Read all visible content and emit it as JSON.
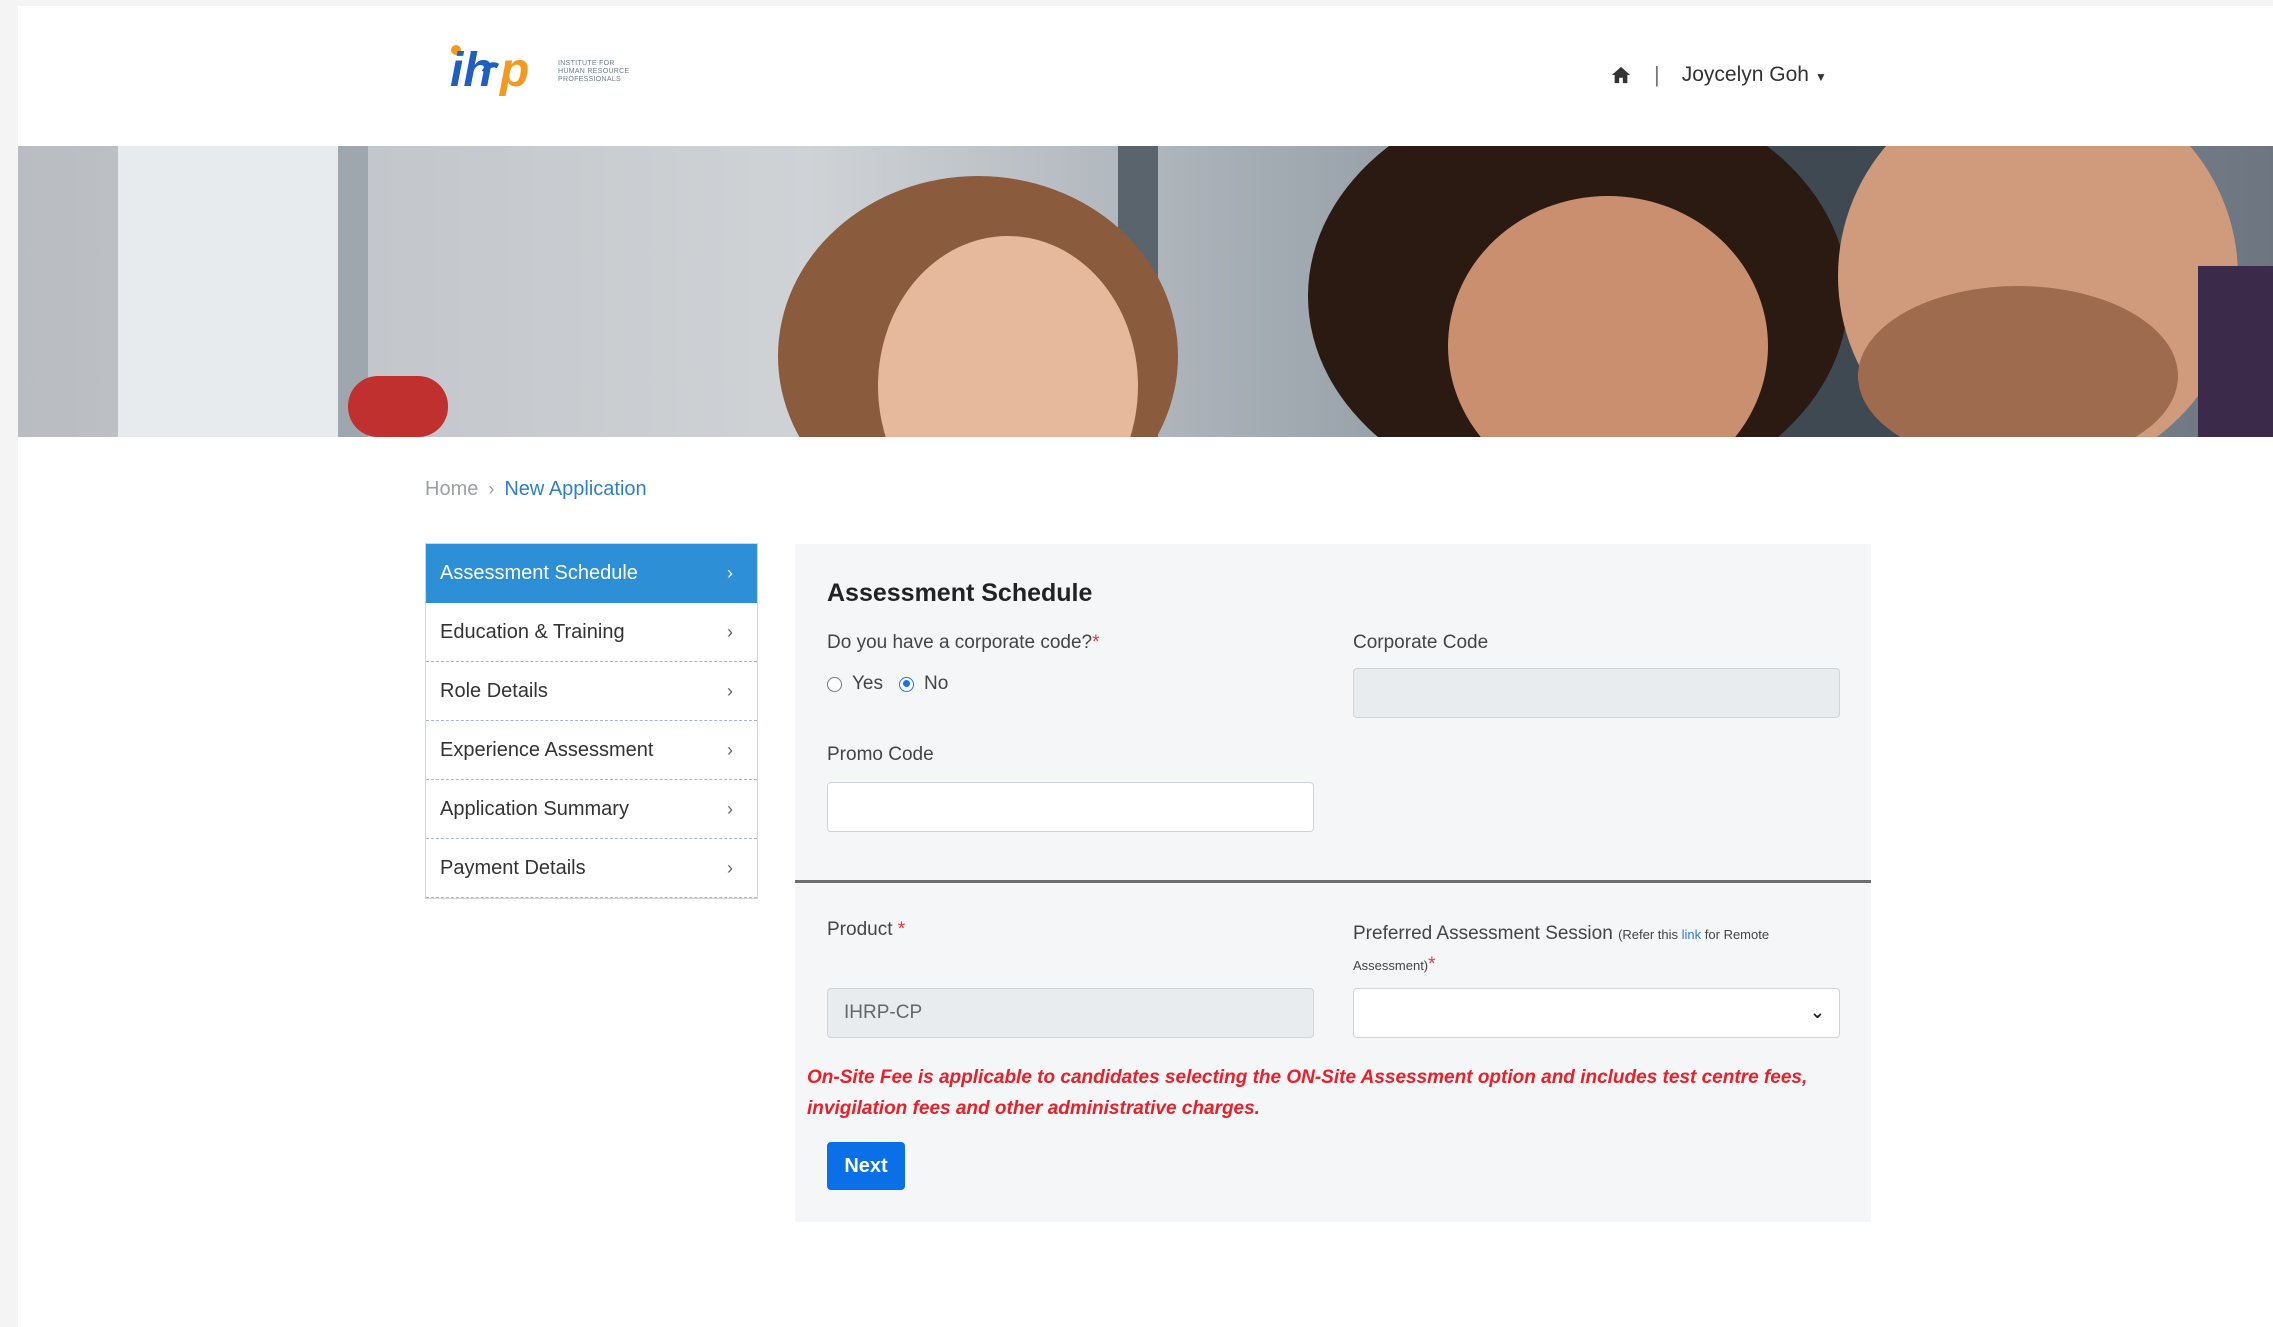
{
  "header": {
    "logo_text": "ihrp",
    "logo_tagline": "INSTITUTE FOR HUMAN RESOURCE PROFESSIONALS",
    "user_name": "Joycelyn Goh",
    "separator": "|",
    "home_icon": "home-icon"
  },
  "breadcrumb": {
    "home": "Home",
    "separator": "›",
    "current": "New Application"
  },
  "sidebar": {
    "items": [
      {
        "label": "Assessment Schedule",
        "active": true
      },
      {
        "label": "Education & Training",
        "active": false
      },
      {
        "label": "Role Details",
        "active": false
      },
      {
        "label": "Experience Assessment",
        "active": false
      },
      {
        "label": "Application Summary",
        "active": false
      },
      {
        "label": "Payment Details",
        "active": false
      }
    ],
    "chevron": "›"
  },
  "form": {
    "title": "Assessment Schedule",
    "corporate_question": "Do you have a corporate code?",
    "required_mark": "*",
    "radio_yes": "Yes",
    "radio_no": "No",
    "selected_option": "No",
    "corporate_code_label": "Corporate Code",
    "corporate_code_value": "",
    "promo_code_label": "Promo Code",
    "promo_code_value": "",
    "product_label": "Product",
    "product_value": "IHRP-CP",
    "session_label": "Preferred Assessment Session",
    "session_note_prefix": "(Refer this ",
    "session_note_link": "link",
    "session_note_suffix": " for Remote",
    "session_note_line2": "Assessment)",
    "session_value": "",
    "notice": "On-Site Fee is applicable to candidates selecting the ON-Site Assessment option and includes test centre fees, invigilation fees and other administrative charges.",
    "next_label": "Next"
  },
  "colors": {
    "brand_blue": "#1f5fbf",
    "brand_orange": "#f29a1f",
    "active_tab": "#2d8fd5",
    "button": "#0b6fe8",
    "notice": "#e8202a"
  }
}
